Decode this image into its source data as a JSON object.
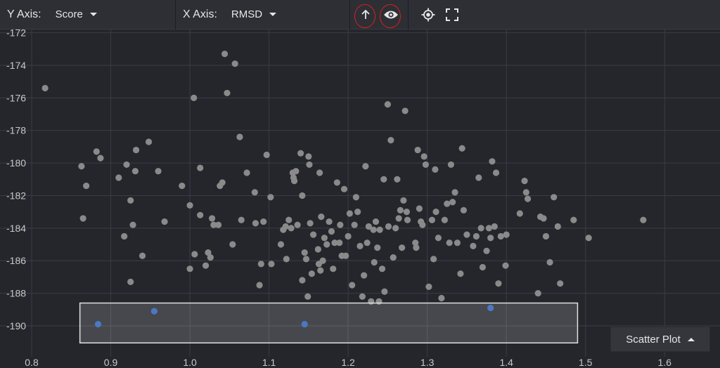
{
  "toolbar": {
    "y_axis_label": "Y Axis:",
    "y_axis_value": "Score",
    "x_axis_label": "X Axis:",
    "x_axis_value": "RMSD",
    "icons": [
      "arrow-up-icon",
      "eye-icon",
      "locate-icon",
      "fullscreen-icon"
    ]
  },
  "chart_type_button": "Scatter Plot",
  "colors": {
    "background": "#24262c",
    "point": "#8a8a8a",
    "selected_point": "#4a78c4",
    "highlight_ring": "#d82020",
    "selection_box": "#e0e0e0"
  },
  "chart_data": {
    "type": "scatter",
    "xlim": [
      0.76,
      1.67
    ],
    "ylim": [
      -191.9,
      -171.8
    ],
    "x_ticks": [
      0.8,
      0.9,
      1.0,
      1.1,
      1.2,
      1.3,
      1.4,
      1.5,
      1.6
    ],
    "x_tick_labels": [
      "0.8",
      "0.9",
      "1.0",
      "1.1",
      "1.2",
      "1.3",
      "1.4",
      "1.5",
      "1.6"
    ],
    "y_ticks": [
      -172,
      -174,
      -176,
      -178,
      -180,
      -182,
      -184,
      -186,
      -188,
      -190
    ],
    "y_tick_labels": [
      "-172",
      "-174",
      "-176",
      "-178",
      "-180",
      "-182",
      "-184",
      "-186",
      "-188",
      "-190"
    ],
    "grid": true,
    "selection": {
      "x_range": [
        0.861,
        1.49
      ],
      "y_range": [
        -191.05,
        -188.6
      ]
    },
    "series": [
      {
        "points": [
          [
            0.817,
            -175.4
          ],
          [
            0.863,
            -180.2
          ],
          [
            0.865,
            -183.4
          ],
          [
            0.869,
            -181.4
          ],
          [
            0.882,
            -179.3
          ],
          [
            0.887,
            -179.7
          ],
          [
            0.91,
            -180.9
          ],
          [
            0.917,
            -184.5
          ],
          [
            0.92,
            -180.1
          ],
          [
            0.925,
            -182.3
          ],
          [
            0.925,
            -187.3
          ],
          [
            0.928,
            -183.8
          ],
          [
            0.931,
            -180.5
          ],
          [
            0.932,
            -179.2
          ],
          [
            0.94,
            -185.7
          ],
          [
            0.948,
            -178.7
          ],
          [
            0.96,
            -180.5
          ],
          [
            0.968,
            -183.6
          ],
          [
            0.99,
            -181.4
          ],
          [
            1.0,
            -186.5
          ],
          [
            1.0,
            -182.6
          ],
          [
            1.005,
            -176.0
          ],
          [
            1.006,
            -185.6
          ],
          [
            1.013,
            -180.3
          ],
          [
            1.013,
            -183.2
          ],
          [
            1.02,
            -186.3
          ],
          [
            1.023,
            -185.5
          ],
          [
            1.026,
            -185.8
          ],
          [
            1.028,
            -183.4
          ],
          [
            1.03,
            -183.8
          ],
          [
            1.036,
            -183.8
          ],
          [
            1.038,
            -181.4
          ],
          [
            1.041,
            -181.2
          ],
          [
            1.044,
            -173.3
          ],
          [
            1.047,
            -175.7
          ],
          [
            1.054,
            -185.0
          ],
          [
            1.057,
            -173.9
          ],
          [
            1.063,
            -178.4
          ],
          [
            1.065,
            -183.5
          ],
          [
            1.072,
            -180.6
          ],
          [
            1.082,
            -181.8
          ],
          [
            1.083,
            -183.7
          ],
          [
            1.088,
            -187.5
          ],
          [
            1.09,
            -186.2
          ],
          [
            1.093,
            -183.6
          ],
          [
            1.097,
            -179.5
          ],
          [
            1.102,
            -182.1
          ],
          [
            1.103,
            -186.2
          ],
          [
            1.115,
            -185.0
          ],
          [
            1.118,
            -184.1
          ],
          [
            1.121,
            -183.9
          ],
          [
            1.122,
            -185.9
          ],
          [
            1.125,
            -183.5
          ],
          [
            1.128,
            -184.0
          ],
          [
            1.13,
            -180.6
          ],
          [
            1.131,
            -180.9
          ],
          [
            1.132,
            -181.1
          ],
          [
            1.134,
            -180.5
          ],
          [
            1.136,
            -183.8
          ],
          [
            1.14,
            -179.4
          ],
          [
            1.142,
            -182.0
          ],
          [
            1.142,
            -187.2
          ],
          [
            1.145,
            -185.5
          ],
          [
            1.147,
            -185.9
          ],
          [
            1.149,
            -188.2
          ],
          [
            1.15,
            -179.6
          ],
          [
            1.151,
            -180.1
          ],
          [
            1.152,
            -183.7
          ],
          [
            1.154,
            -186.8
          ],
          [
            1.156,
            -184.4
          ],
          [
            1.162,
            -185.3
          ],
          [
            1.163,
            -186.2
          ],
          [
            1.164,
            -180.6
          ],
          [
            1.165,
            -186.6
          ],
          [
            1.166,
            -183.3
          ],
          [
            1.168,
            -186.0
          ],
          [
            1.17,
            -184.6
          ],
          [
            1.173,
            -185.0
          ],
          [
            1.176,
            -183.6
          ],
          [
            1.179,
            -184.2
          ],
          [
            1.181,
            -186.5
          ],
          [
            1.183,
            -184.9
          ],
          [
            1.186,
            -181.2
          ],
          [
            1.189,
            -184.9
          ],
          [
            1.19,
            -183.8
          ],
          [
            1.192,
            -185.7
          ],
          [
            1.195,
            -181.6
          ],
          [
            1.197,
            -185.7
          ],
          [
            1.2,
            -184.5
          ],
          [
            1.202,
            -183.1
          ],
          [
            1.205,
            -187.5
          ],
          [
            1.208,
            -183.8
          ],
          [
            1.21,
            -182.1
          ],
          [
            1.212,
            -183.0
          ],
          [
            1.215,
            -185.1
          ],
          [
            1.218,
            -188.2
          ],
          [
            1.22,
            -186.9
          ],
          [
            1.222,
            -180.2
          ],
          [
            1.224,
            -184.9
          ],
          [
            1.226,
            -183.9
          ],
          [
            1.229,
            -188.5
          ],
          [
            1.232,
            -184.1
          ],
          [
            1.233,
            -186.1
          ],
          [
            1.235,
            -183.6
          ],
          [
            1.237,
            -185.2
          ],
          [
            1.239,
            -188.5
          ],
          [
            1.24,
            -184.1
          ],
          [
            1.243,
            -186.5
          ],
          [
            1.245,
            -181.0
          ],
          [
            1.246,
            -187.9
          ],
          [
            1.25,
            -176.4
          ],
          [
            1.251,
            -183.9
          ],
          [
            1.254,
            -178.6
          ],
          [
            1.257,
            -185.8
          ],
          [
            1.26,
            -184.0
          ],
          [
            1.262,
            -181.0
          ],
          [
            1.264,
            -183.4
          ],
          [
            1.266,
            -182.9
          ],
          [
            1.268,
            -185.2
          ],
          [
            1.27,
            -182.3
          ],
          [
            1.272,
            -176.8
          ],
          [
            1.274,
            -183.0
          ],
          [
            1.275,
            -183.5
          ],
          [
            1.285,
            -184.9
          ],
          [
            1.286,
            -185.2
          ],
          [
            1.288,
            -179.2
          ],
          [
            1.29,
            -182.8
          ],
          [
            1.292,
            -183.6
          ],
          [
            1.294,
            -183.8
          ],
          [
            1.296,
            -179.6
          ],
          [
            1.298,
            -180.1
          ],
          [
            1.302,
            -187.6
          ],
          [
            1.306,
            -183.5
          ],
          [
            1.308,
            -185.9
          ],
          [
            1.31,
            -180.4
          ],
          [
            1.311,
            -183.0
          ],
          [
            1.314,
            -184.6
          ],
          [
            1.318,
            -188.3
          ],
          [
            1.322,
            -183.5
          ],
          [
            1.325,
            -182.5
          ],
          [
            1.328,
            -184.9
          ],
          [
            1.33,
            -180.1
          ],
          [
            1.332,
            -182.4
          ],
          [
            1.335,
            -181.8
          ],
          [
            1.338,
            -184.9
          ],
          [
            1.342,
            -186.8
          ],
          [
            1.344,
            -179.1
          ],
          [
            1.346,
            -182.9
          ],
          [
            1.35,
            -184.4
          ],
          [
            1.358,
            -185.1
          ],
          [
            1.362,
            -184.5
          ],
          [
            1.365,
            -180.9
          ],
          [
            1.368,
            -184.0
          ],
          [
            1.37,
            -186.4
          ],
          [
            1.375,
            -185.4
          ],
          [
            1.378,
            -184.0
          ],
          [
            1.38,
            -184.6
          ],
          [
            1.382,
            -179.9
          ],
          [
            1.385,
            -183.9
          ],
          [
            1.387,
            -180.6
          ],
          [
            1.39,
            -187.4
          ],
          [
            1.393,
            -184.5
          ],
          [
            1.399,
            -186.3
          ],
          [
            1.4,
            -184.4
          ],
          [
            1.417,
            -183.1
          ],
          [
            1.423,
            -181.1
          ],
          [
            1.425,
            -181.8
          ],
          [
            1.427,
            -182.2
          ],
          [
            1.44,
            -188.0
          ],
          [
            1.443,
            -183.3
          ],
          [
            1.447,
            -183.4
          ],
          [
            1.45,
            -184.5
          ],
          [
            1.455,
            -186.1
          ],
          [
            1.46,
            -182.1
          ],
          [
            1.465,
            -183.9
          ],
          [
            1.468,
            -187.4
          ],
          [
            1.485,
            -183.5
          ],
          [
            1.504,
            -184.6
          ],
          [
            1.573,
            -183.5
          ]
        ]
      },
      {
        "points": [
          [
            0.884,
            -189.9
          ],
          [
            0.955,
            -189.1
          ],
          [
            1.145,
            -189.9
          ],
          [
            1.38,
            -188.9
          ]
        ]
      }
    ]
  }
}
